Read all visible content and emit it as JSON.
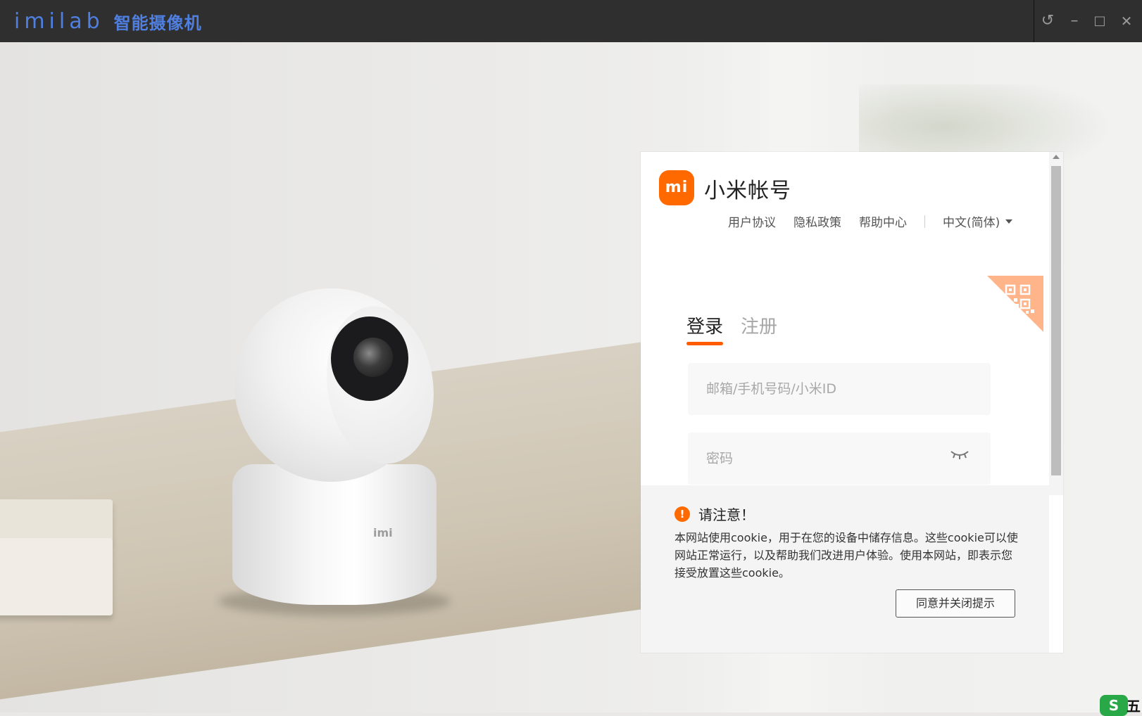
{
  "window": {
    "brand_logo": "imilab",
    "brand_title": "智能摄像机",
    "buttons": {
      "back": "↺",
      "minimize": "–",
      "maximize": "□",
      "close": "✕"
    }
  },
  "background": {
    "camera_logo": "imi"
  },
  "login": {
    "logo_text": "mi",
    "title": "小米帐号",
    "links": [
      "用户协议",
      "隐私政策",
      "帮助中心"
    ],
    "language": "中文(简体)",
    "tabs": [
      {
        "label": "登录",
        "active": true
      },
      {
        "label": "注册",
        "active": false
      }
    ],
    "account_placeholder": "邮箱/手机号码/小米ID",
    "password_placeholder": "密码"
  },
  "notice": {
    "icon": "!",
    "title": "请注意！",
    "body": "本网站使用cookie，用于在您的设备中储存信息。这些cookie可以使网站正常运行，以及帮助我们改进用户体验。使用本网站，即表示您接受放置这些cookie。",
    "button": "同意并关闭提示"
  },
  "colors": {
    "accent": "#ff6900",
    "brand_blue": "#4f7fe0",
    "titlebar": "#2f2f2f"
  },
  "icons": [
    "undo-icon",
    "minimize-icon",
    "maximize-icon",
    "close-icon",
    "qr-code-icon",
    "eye-closed-icon",
    "warning-icon",
    "chevron-down-icon"
  ],
  "taskbar_badge": {
    "icon": "S",
    "text": "五"
  }
}
